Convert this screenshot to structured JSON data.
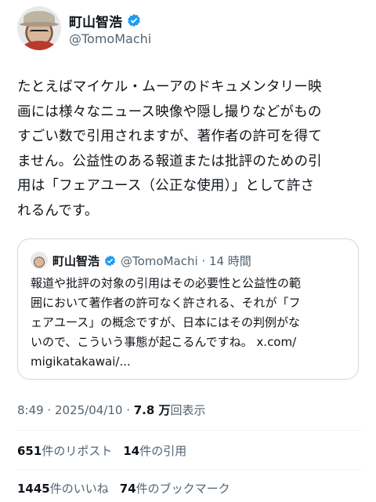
{
  "author": {
    "display_name": "町山智浩",
    "handle": "@TomoMachi",
    "verified_color": "#1d9bf0"
  },
  "tweet": {
    "text": "たとえばマイケル・ムーアのドキュメンタリー映\n画には様々なニュース映像や隠し撮りなどがもの\nすごい数で引用されますが、著作者の許可を得て\nません。公益性のある報道または批評のための引\n用は「フェアユース（公正な使用）」として許さ\nれるんです。"
  },
  "quoted_tweet": {
    "display_name": "町山智浩",
    "meta": "@TomoMachi · 14 時間",
    "text": "報道や批評の対象の引用はその必要性と公益性の範\n囲において著作者の許可なく許される、それが「フ\nェアユース」の概念ですが、日本にはその判例がな\nいので、こういう事態が起こるんですね。 x.com/\nmigikatakawai/..."
  },
  "timestamp": {
    "time_date": "8:49 · 2025/04/10 · ",
    "views": "7.8 万",
    "views_label": "回表示"
  },
  "stats": {
    "reposts_count": "651",
    "reposts_label": "件のリポスト",
    "quotes_count": "14",
    "quotes_label": "件の引用",
    "likes_count": "1445",
    "likes_label": "件のいいね",
    "bookmarks_count": "74",
    "bookmarks_label": "件のブックマーク"
  }
}
